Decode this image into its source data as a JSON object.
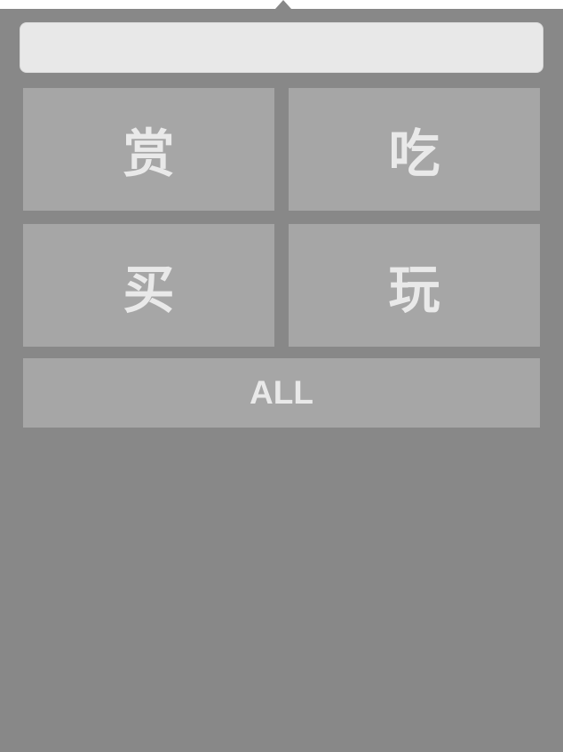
{
  "search": {
    "value": "",
    "placeholder": ""
  },
  "categories": [
    {
      "label": "赏"
    },
    {
      "label": "吃"
    },
    {
      "label": "买"
    },
    {
      "label": "玩"
    }
  ],
  "all_button": {
    "label": "ALL"
  },
  "colors": {
    "popover_bg": "#888888",
    "tile_bg": "#a6a6a6",
    "tile_text": "#e9e9e9",
    "search_bg": "#e8e8e8"
  }
}
